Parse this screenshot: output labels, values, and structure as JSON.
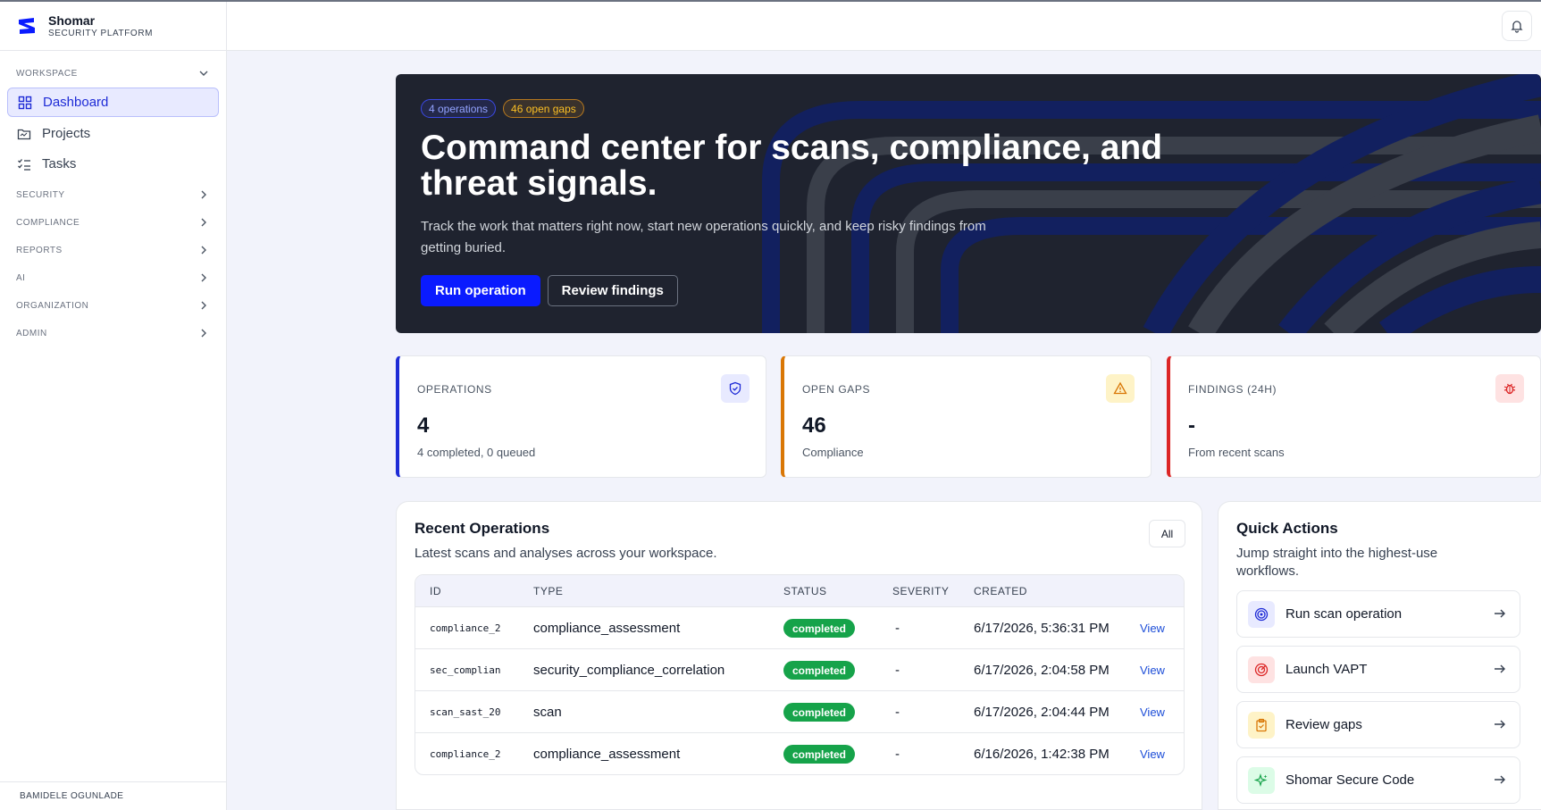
{
  "brand": {
    "name": "Shomar",
    "subtitle": "SECURITY PLATFORM"
  },
  "sidebar": {
    "workspace_label": "WORKSPACE",
    "items": [
      {
        "label": "Dashboard",
        "icon": "dashboard-grid-icon",
        "active": true
      },
      {
        "label": "Projects",
        "icon": "folder-icon",
        "active": false
      },
      {
        "label": "Tasks",
        "icon": "checklist-icon",
        "active": false
      }
    ],
    "sections": [
      "SECURITY",
      "COMPLIANCE",
      "REPORTS",
      "AI",
      "ORGANIZATION",
      "ADMIN"
    ],
    "user": "BAMIDELE OGUNLADE"
  },
  "hero": {
    "badge_operations": "4 operations",
    "badge_gaps": "46 open gaps",
    "title": "Command center for scans, compliance, and threat signals.",
    "description": "Track the work that matters right now, start new operations quickly, and keep risky findings from getting buried.",
    "primary_button": "Run operation",
    "secondary_button": "Review findings"
  },
  "stats": [
    {
      "label": "OPERATIONS",
      "value": "4",
      "sub": "4 completed, 0 queued",
      "icon": "shield-check-icon",
      "color": "#1e2bd6"
    },
    {
      "label": "OPEN GAPS",
      "value": "46",
      "sub": "Compliance",
      "icon": "warning-triangle-icon",
      "color": "#d97706"
    },
    {
      "label": "FINDINGS (24H)",
      "value": "-",
      "sub": "From recent scans",
      "icon": "bug-icon",
      "color": "#dc2626"
    }
  ],
  "recent_operations": {
    "title": "Recent Operations",
    "subtitle": "Latest scans and analyses across your workspace.",
    "filter_button": "All",
    "columns": [
      "ID",
      "TYPE",
      "STATUS",
      "SEVERITY",
      "CREATED"
    ],
    "rows": [
      {
        "id": "compliance_2",
        "type": "compliance_assessment",
        "status": "completed",
        "severity": "-",
        "created": "6/17/2026, 5:36:31 PM",
        "action": "View"
      },
      {
        "id": "sec_complian",
        "type": "security_compliance_correlation",
        "status": "completed",
        "severity": "-",
        "created": "6/17/2026, 2:04:58 PM",
        "action": "View"
      },
      {
        "id": "scan_sast_20",
        "type": "scan",
        "status": "completed",
        "severity": "-",
        "created": "6/17/2026, 2:04:44 PM",
        "action": "View"
      },
      {
        "id": "compliance_2",
        "type": "compliance_assessment",
        "status": "completed",
        "severity": "-",
        "created": "6/16/2026, 1:42:38 PM",
        "action": "View"
      }
    ]
  },
  "quick_actions": {
    "title": "Quick Actions",
    "subtitle": "Jump straight into the highest-use workflows.",
    "items": [
      {
        "label": "Run scan operation",
        "icon": "target-icon",
        "color": "#1e2bd6"
      },
      {
        "label": "Launch VAPT",
        "icon": "radar-icon",
        "color": "#dc2626"
      },
      {
        "label": "Review gaps",
        "icon": "clipboard-icon",
        "color": "#d97706"
      },
      {
        "label": "Shomar Secure Code",
        "icon": "sparkle-icon",
        "color": "#16a34a"
      }
    ]
  },
  "colors": {
    "accent": "#0a1bff",
    "hero_bg": "#1f232f",
    "success": "#16a34a"
  }
}
